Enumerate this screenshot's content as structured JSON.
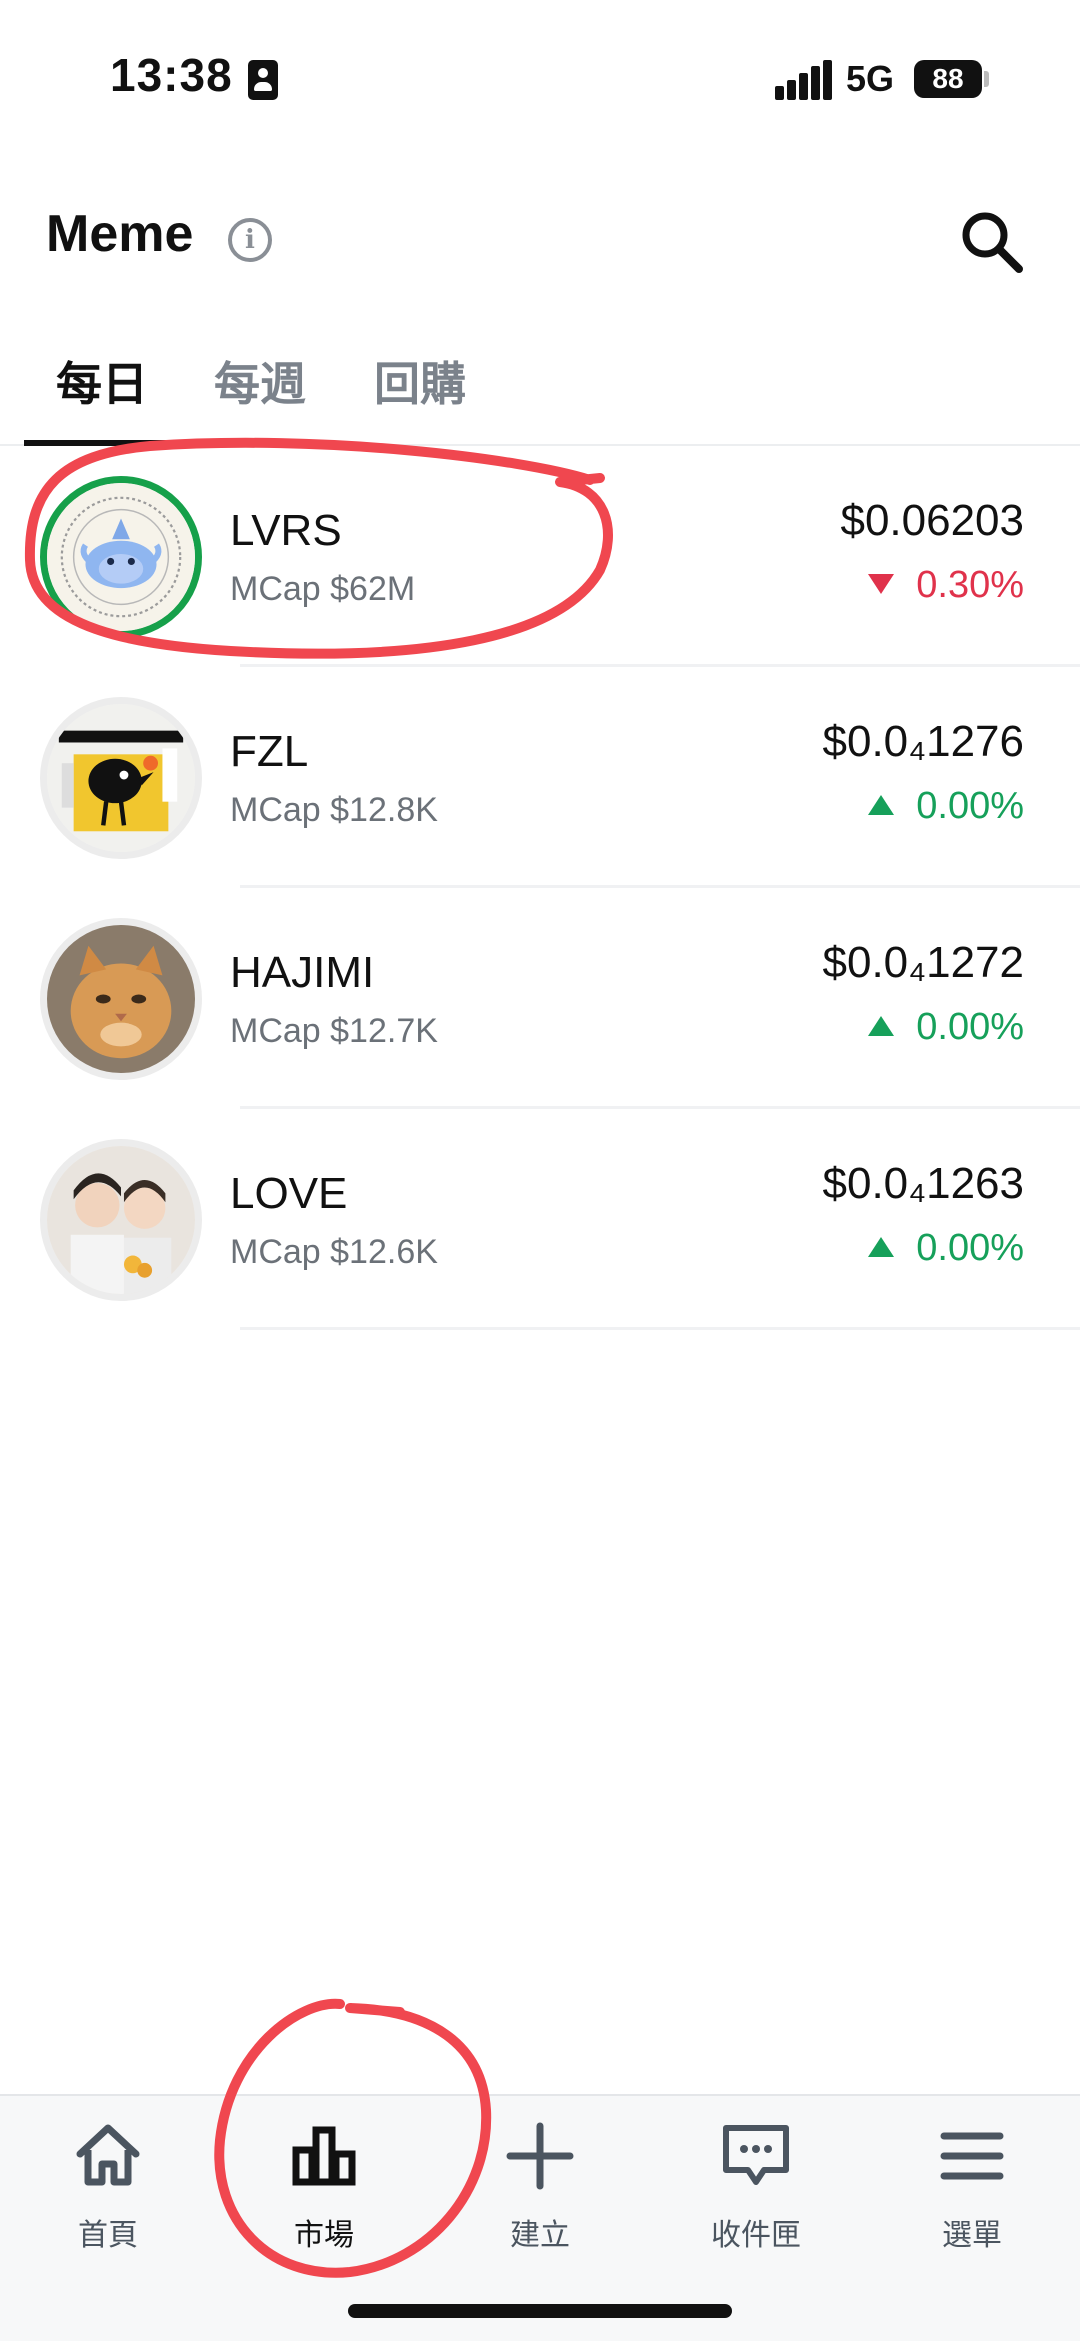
{
  "status_bar": {
    "time": "13:38",
    "network": "5G",
    "battery": "88"
  },
  "header": {
    "title": "Meme",
    "info_glyph": "i"
  },
  "tabs": [
    {
      "label": "每日",
      "active": true
    },
    {
      "label": "每週",
      "active": false
    },
    {
      "label": "回購",
      "active": false
    }
  ],
  "coins": [
    {
      "name": "LVRS",
      "mcap": "MCap $62M",
      "price": "$0.06203",
      "change": "0.30%",
      "direction": "down",
      "avatar": "blue-spirit-badge"
    },
    {
      "name": "FZL",
      "mcap": "MCap $12.8K",
      "price": "$0.0₄1276",
      "change": "0.00%",
      "direction": "up",
      "avatar": "clockwork-crow-poster"
    },
    {
      "name": "HAJIMI",
      "mcap": "MCap $12.7K",
      "price": "$0.0₄1272",
      "change": "0.00%",
      "direction": "up",
      "avatar": "orange-cat-photo"
    },
    {
      "name": "LOVE",
      "mcap": "MCap $12.6K",
      "price": "$0.0₄1263",
      "change": "0.00%",
      "direction": "up",
      "avatar": "two-people-photo"
    }
  ],
  "bottom_nav": [
    {
      "label": "首頁",
      "icon": "home-icon",
      "active": false
    },
    {
      "label": "市場",
      "icon": "market-chart-icon",
      "active": true
    },
    {
      "label": "建立",
      "icon": "plus-icon",
      "active": false
    },
    {
      "label": "收件匣",
      "icon": "chat-inbox-icon",
      "active": false
    },
    {
      "label": "選單",
      "icon": "menu-icon",
      "active": false
    }
  ],
  "colors": {
    "up": "#16a05a",
    "down": "#e0324b",
    "annotation": "#f0474f",
    "ring": "#16a04a"
  }
}
